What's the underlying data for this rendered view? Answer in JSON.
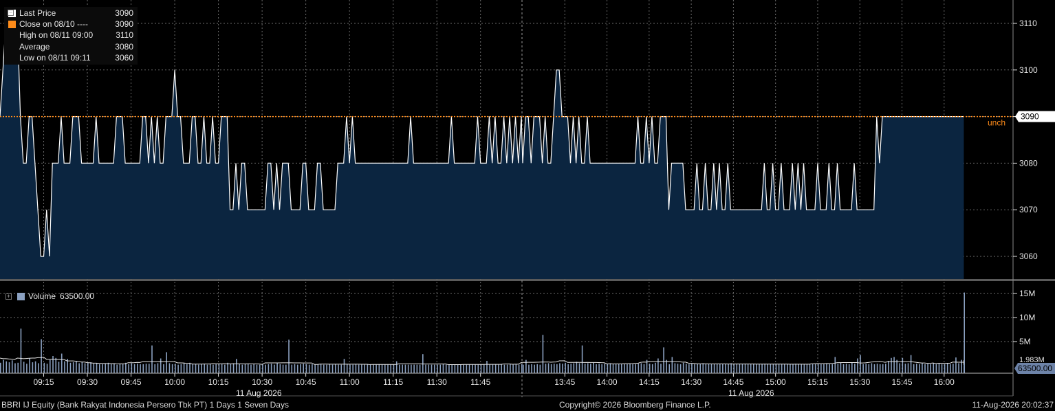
{
  "colors": {
    "area": "#0b2540",
    "line": "#ffffff",
    "grid": "#6b6b6b",
    "close": "#ff8c1a",
    "volume": "#8ba1c1",
    "axis": "#e6e6e6"
  },
  "legend": {
    "items": [
      {
        "label": "Last Price",
        "value": "3090",
        "swatch": "#ffffff"
      },
      {
        "label": "Close on 08/10 ----",
        "value": "3090",
        "swatch": "#ff8c1a"
      },
      {
        "label": "High on 08/11 09:00",
        "value": "3110",
        "swatch": ""
      },
      {
        "label": "Average",
        "value": "3080",
        "swatch": ""
      },
      {
        "label": "Low on 08/11 09:11",
        "value": "3060",
        "swatch": ""
      }
    ]
  },
  "volume_legend": {
    "label": "Volume",
    "value": "63500.00"
  },
  "price_axis": {
    "ticks": [
      "3110",
      "3100",
      "3090",
      "3080",
      "3070",
      "3060"
    ],
    "last_tag": "3090",
    "unch": "unch"
  },
  "volume_axis": {
    "ticks": [
      "15M",
      "10M",
      "5M"
    ],
    "last_tag": "63500.00",
    "avg_tag": "1.983M"
  },
  "time_axis": {
    "morning": [
      "09:15",
      "09:30",
      "09:45",
      "10:00",
      "10:15",
      "10:30",
      "10:45",
      "11:00",
      "11:15",
      "11:30",
      "11:45"
    ],
    "afternoon": [
      "13:45",
      "14:00",
      "14:15",
      "14:30",
      "14:45",
      "15:00",
      "15:15",
      "15:30",
      "15:45",
      "16:00"
    ],
    "date_left": "11 Aug 2026",
    "date_right": "11 Aug 2026"
  },
  "footer": {
    "left": "BBRI IJ Equity (Bank Rakyat Indonesia Persero Tbk PT) 1 Days 1 Seven Days",
    "center": "Copyright© 2026 Bloomberg Finance L.P.",
    "right": "11-Aug-2026 20:02:37"
  },
  "chart_data": {
    "type": "area",
    "ylim": [
      3055,
      3115
    ],
    "close_line": 3090,
    "sessions": [
      {
        "start": "09:00",
        "end": "12:00",
        "minutes": 180
      },
      {
        "start": "13:30",
        "end": "16:15",
        "minutes": 165
      }
    ],
    "price": [
      3090,
      3100,
      3110,
      3110,
      3110,
      3110,
      3110,
      3090,
      3080,
      3080,
      3090,
      3090,
      3080,
      3070,
      3060,
      3060,
      3070,
      3060,
      3080,
      3080,
      3080,
      3090,
      3080,
      3080,
      3080,
      3090,
      3090,
      3090,
      3080,
      3080,
      3080,
      3080,
      3080,
      3090,
      3080,
      3080,
      3080,
      3080,
      3080,
      3080,
      3090,
      3090,
      3090,
      3080,
      3080,
      3080,
      3080,
      3080,
      3080,
      3090,
      3090,
      3080,
      3090,
      3080,
      3090,
      3080,
      3080,
      3090,
      3090,
      3090,
      3100,
      3090,
      3090,
      3080,
      3080,
      3080,
      3090,
      3090,
      3080,
      3080,
      3090,
      3080,
      3080,
      3090,
      3080,
      3080,
      3090,
      3090,
      3090,
      3070,
      3070,
      3080,
      3070,
      3080,
      3080,
      3070,
      3070,
      3070,
      3070,
      3070,
      3070,
      3070,
      3080,
      3080,
      3070,
      3080,
      3070,
      3080,
      3080,
      3080,
      3070,
      3070,
      3070,
      3070,
      3080,
      3080,
      3070,
      3070,
      3070,
      3080,
      3080,
      3070,
      3070,
      3070,
      3070,
      3070,
      3080,
      3080,
      3080,
      3090,
      3080,
      3090,
      3080,
      3080,
      3080,
      3080,
      3080,
      3080,
      3080,
      3080,
      3080,
      3080,
      3080,
      3080,
      3080,
      3080,
      3080,
      3080,
      3080,
      3080,
      3080,
      3090,
      3080,
      3080,
      3080,
      3080,
      3080,
      3080,
      3080,
      3080,
      3080,
      3080,
      3080,
      3080,
      3080,
      3090,
      3080,
      3080,
      3080,
      3080,
      3080,
      3080,
      3080,
      3080,
      3090,
      3080,
      3080,
      3080,
      3090,
      3080,
      3090,
      3080,
      3080,
      3090,
      3080,
      3090,
      3080,
      3090,
      3080,
      3090,
      3080,
      3090,
      3090,
      3080,
      3090,
      3090,
      3090,
      3080,
      3090,
      3080,
      3080,
      3090,
      3100,
      3100,
      3090,
      3090,
      3090,
      3080,
      3090,
      3080,
      3090,
      3080,
      3080,
      3090,
      3080,
      3080,
      3080,
      3080,
      3080,
      3080,
      3080,
      3080,
      3080,
      3080,
      3080,
      3080,
      3080,
      3080,
      3080,
      3080,
      3080,
      3090,
      3080,
      3080,
      3090,
      3080,
      3090,
      3080,
      3080,
      3090,
      3090,
      3090,
      3070,
      3080,
      3080,
      3080,
      3080,
      3080,
      3070,
      3070,
      3070,
      3070,
      3080,
      3070,
      3070,
      3080,
      3070,
      3070,
      3080,
      3070,
      3080,
      3070,
      3070,
      3080,
      3070,
      3070,
      3070,
      3070,
      3070,
      3070,
      3070,
      3070,
      3070,
      3070,
      3070,
      3070,
      3080,
      3070,
      3070,
      3080,
      3070,
      3070,
      3080,
      3070,
      3070,
      3070,
      3080,
      3070,
      3080,
      3070,
      3080,
      3070,
      3070,
      3070,
      3070,
      3080,
      3070,
      3070,
      3070,
      3080,
      3070,
      3070,
      3080,
      3070,
      3070,
      3070,
      3070,
      3070,
      3080,
      3070,
      3070,
      3070,
      3070,
      3070,
      3070,
      3070,
      3090,
      3080,
      3090,
      3090,
      3090,
      3090,
      3090,
      3090,
      3090,
      3090,
      3090,
      3090,
      3090,
      3090,
      3090,
      3090,
      3090,
      3090,
      3090,
      3090,
      3090,
      3090,
      3090,
      3090,
      3090,
      3090,
      3090,
      3090,
      3090,
      3090,
      3090,
      3090
    ],
    "volume_m": [
      0.6,
      1.2,
      0.9,
      0.7,
      1.1,
      0.5,
      0.6,
      7.7,
      0.8,
      0.4,
      1.5,
      0.7,
      0.9,
      0.5,
      5.5,
      0.6,
      0.4,
      1.2,
      2.0,
      1.6,
      0.8,
      2.5,
      0.9,
      1.4,
      0.6,
      0.7,
      1.0,
      0.5,
      0.8,
      0.5,
      0.6,
      0.7,
      0.4,
      0.5,
      0.3,
      0.3,
      0.4,
      0.6,
      0.3,
      0.5,
      0.2,
      0.4,
      0.3,
      0.6,
      0.3,
      0.5,
      0.3,
      0.4,
      0.3,
      0.3,
      0.4,
      0.4,
      4.2,
      0.3,
      0.5,
      1.5,
      0.3,
      2.8,
      0.5,
      0.3,
      0.4,
      0.2,
      0.3,
      0.5,
      0.3,
      0.6,
      0.4,
      0.3,
      0.2,
      0.3,
      0.4,
      0.2,
      0.3,
      0.2,
      0.3,
      0.4,
      0.3,
      0.2,
      0.6,
      0.3,
      0.5,
      1.4,
      0.3,
      0.2,
      0.3,
      0.4,
      0.2,
      0.3,
      0.2,
      0.2,
      0.3,
      0.2,
      0.3,
      0.4,
      0.2,
      0.5,
      0.3,
      0.2,
      0.2,
      5.4,
      0.2,
      0.3,
      0.2,
      0.3,
      0.4,
      0.3,
      0.2,
      0.3,
      0.2,
      0.2,
      0.3,
      0.2,
      0.2,
      0.3,
      0.2,
      0.3,
      0.2,
      0.2,
      1.4,
      0.3,
      0.2,
      0.2,
      0.3,
      0.2,
      0.2,
      0.2,
      0.3,
      0.2,
      0.2,
      0.2,
      0.3,
      0.2,
      0.2,
      0.2,
      0.2,
      0.2,
      0.9,
      0.2,
      0.2,
      0.2,
      0.2,
      0.2,
      0.2,
      0.2,
      0.2,
      2.4,
      0.2,
      0.2,
      0.2,
      0.2,
      0.2,
      0.2,
      0.3,
      0.2,
      0.2,
      0.2,
      0.2,
      0.2,
      0.2,
      0.2,
      0.2,
      0.2,
      0.2,
      0.2,
      0.2,
      0.2,
      0.2,
      1.0,
      0.2,
      0.2,
      0.3,
      0.2,
      0.3,
      0.2,
      0.2,
      0.3,
      0.2,
      0.3,
      0.2,
      0.3,
      0.2,
      1.2,
      0.2,
      0.3,
      0.2,
      0.3,
      0.2,
      6.4,
      0.4,
      0.5,
      0.3,
      0.4,
      0.3,
      0.5,
      0.4,
      0.6,
      0.3,
      0.4,
      0.5,
      0.8,
      0.5,
      4.2,
      0.4,
      0.5,
      0.4,
      0.6,
      0.3,
      0.4,
      0.3,
      0.4,
      0.3,
      0.5,
      0.3,
      0.4,
      0.3,
      0.4,
      0.3,
      0.3,
      0.4,
      0.3,
      0.3,
      0.4,
      0.5,
      0.3,
      1.2,
      0.4,
      0.3,
      0.6,
      1.5,
      0.4,
      3.8,
      1.2,
      0.3,
      1.8,
      0.5,
      0.4,
      0.3,
      0.6,
      0.4,
      0.3,
      0.5,
      0.3,
      0.4,
      0.3,
      0.5,
      0.3,
      0.4,
      0.3,
      0.4,
      0.3,
      0.3,
      0.4,
      0.3,
      0.3,
      0.5,
      0.3,
      0.4,
      0.3,
      0.3,
      0.4,
      0.3,
      0.3,
      0.4,
      0.3,
      0.3,
      0.3,
      0.4,
      0.3,
      0.3,
      0.3,
      0.4,
      0.3,
      0.3,
      0.3,
      0.3,
      0.3,
      0.3,
      0.4,
      0.3,
      0.3,
      0.3,
      0.3,
      0.3,
      0.3,
      0.3,
      0.3,
      0.3,
      0.3,
      0.4,
      0.3,
      0.3,
      1.8,
      0.4,
      0.6,
      0.3,
      0.4,
      0.3,
      0.6,
      0.4,
      1.5,
      2.2,
      0.3,
      0.4,
      0.3,
      0.5,
      0.3,
      0.4,
      0.3,
      0.3,
      0.4,
      1.0,
      1.6,
      1.8,
      1.2,
      0.5,
      1.6,
      0.4,
      0.5,
      2.2,
      0.3,
      0.4,
      0.3,
      0.5,
      0.3,
      0.4,
      0.3,
      0.5,
      0.3,
      0.4,
      0.3,
      0.3,
      0.5,
      0.3,
      0.4,
      1.7,
      0.5,
      1.2,
      0.3,
      0.4,
      0.3,
      0.3,
      4.5,
      0.3,
      0.2,
      0.3,
      0.2,
      0.3,
      0.2,
      0.3,
      0.2,
      0.3,
      0.2,
      0.3,
      0.2,
      0.3,
      0.2,
      0.3,
      0.2,
      0.3,
      0.2,
      0.3,
      0.2,
      0.2,
      0.3,
      0.2,
      0.2,
      0.2,
      0.3,
      0.2,
      0.2,
      15.2,
      0.3,
      0.3,
      0.3,
      0.3,
      0.3,
      0.2,
      0.2,
      0.2,
      0.2,
      0.2,
      0.2,
      0.2,
      0.2,
      0.2,
      0.2,
      0.2,
      0.2,
      0.2,
      0.2,
      0.2,
      0.2,
      0.2,
      0.2,
      0.2,
      0.2,
      0.2,
      0.2,
      0.2,
      0.2,
      0.2,
      0.2,
      0.2,
      0.2,
      0.2,
      0.2,
      0.2,
      0.2,
      0.2,
      0.2,
      0.2,
      0.2,
      0.2,
      0.2,
      0.2,
      0.2,
      0.2,
      0.2,
      0.2,
      0.2
    ],
    "volume_ylim": [
      0,
      17
    ]
  }
}
